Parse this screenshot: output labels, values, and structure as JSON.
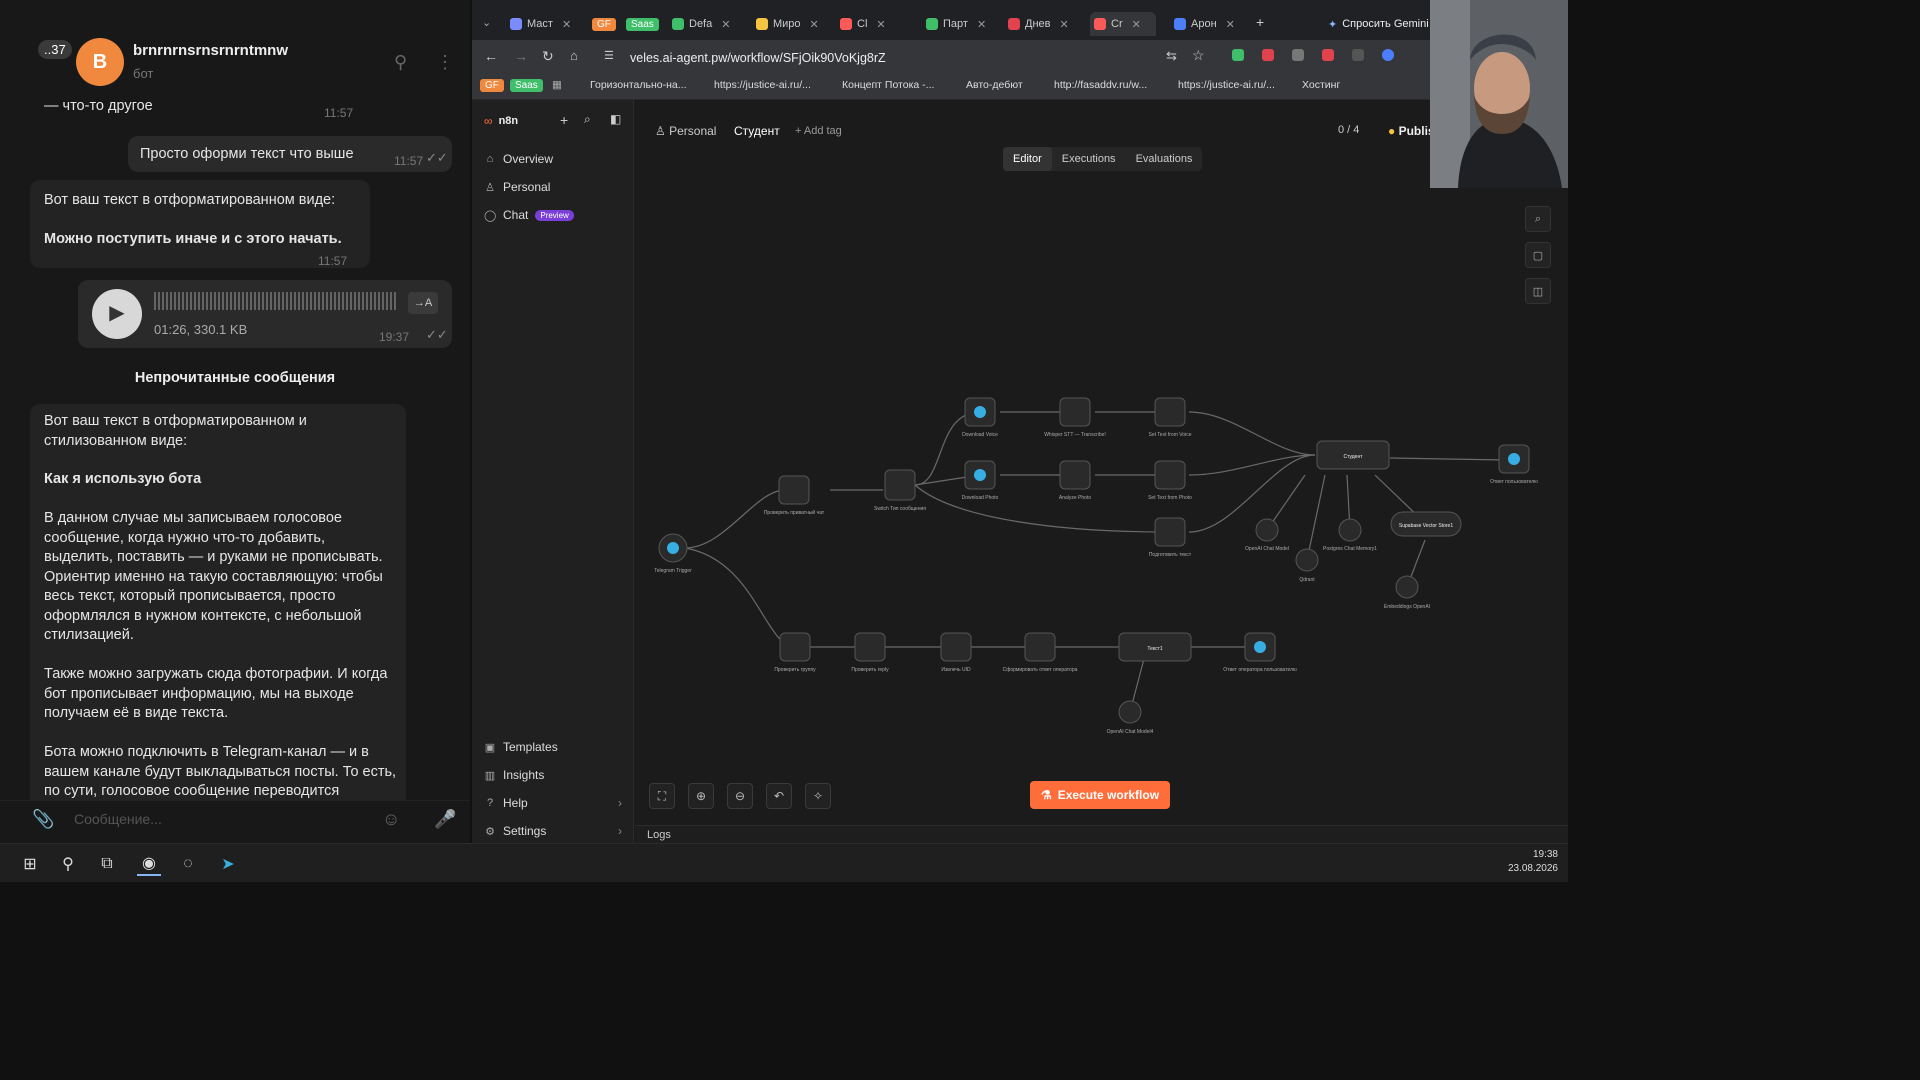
{
  "telegram": {
    "unread_badge": "..37",
    "avatar_letter": "B",
    "chat_name": "brnrnrnsrnsrnrntmnw",
    "chat_status": "бот",
    "messages": [
      {
        "text": "— что-то другое",
        "time": "11:57"
      },
      {
        "text": "Просто оформи текст что выше",
        "time": "11:57",
        "outgoing": true
      },
      {
        "line1": "Вот ваш текст в отформатированном виде:",
        "line2": "Можно поступить иначе и с этого начать.",
        "time": "11:57"
      }
    ],
    "voice": {
      "duration_size": "01:26, 330.1 KB",
      "time": "19:37",
      "transcribe_label": "→A"
    },
    "unread_divider": "Непрочитанные сообщения",
    "long_message": {
      "intro": "Вот ваш текст в отформатированном и стилизованном виде:",
      "heading": "Как я использую бота",
      "p1": "В данном случае мы записываем голосовое сообщение, когда нужно что-то добавить, выделить, поставить — и руками не прописывать. Ориентир именно на такую составляющую: чтобы весь текст, который прописывается, просто оформлялся в нужном контексте, с небольшой стилизацией.",
      "p2": "Также можно загружать сюда фотографии. И когда бот прописывает информацию, мы на выходе получаем её в виде текста.",
      "p3": "Бота можно подключить в Telegram-канал — и в вашем канале будут выкладываться посты. То есть, по сути, голосовое сообщение переводится"
    },
    "input_placeholder": "Сообщение..."
  },
  "browser": {
    "tabs": [
      {
        "label": "Маст",
        "color": "#7a8cff"
      },
      {
        "label": "GF",
        "color": "#f0883e"
      },
      {
        "label": "Saas",
        "color": "#3fbf6a"
      },
      {
        "label": "Defa",
        "color": "#3fbf6a"
      },
      {
        "label": "Миро",
        "color": "#f5c542"
      },
      {
        "label": "Cl",
        "color": "#ff5a5a"
      },
      {
        "label": "Парт",
        "color": "#3fbf6a"
      },
      {
        "label": "Днев",
        "color": "#e0434e"
      },
      {
        "label": "Cr",
        "color": "#ff5a5a"
      },
      {
        "label": "Арон",
        "color": "#4c7fff"
      }
    ],
    "gemini": "Спросить Gemini",
    "url": "veles.ai-agent.pw/workflow/SFjOik90VoKjg8rZ",
    "bookmarks": [
      {
        "label": "GF"
      },
      {
        "label": "Saas"
      },
      {
        "label": "Горизонтально-на..."
      },
      {
        "label": "https://justice-ai.ru/..."
      },
      {
        "label": "Концепт Потока -..."
      },
      {
        "label": "Авто-дебют"
      },
      {
        "label": "http://fasaddv.ru/w..."
      },
      {
        "label": "https://justice-ai.ru/..."
      },
      {
        "label": "Хостинг"
      }
    ]
  },
  "n8n": {
    "brand": "n8n",
    "nav": {
      "overview": "Overview",
      "personal": "Personal",
      "chat": "Chat",
      "chat_badge": "Preview"
    },
    "bottom_nav": {
      "templates": "Templates",
      "insights": "Insights",
      "help": "Help",
      "settings": "Settings"
    },
    "breadcrumb": {
      "project": "Personal",
      "workflow": "Студент",
      "add_tag": "+ Add tag"
    },
    "counter": "0 / 4",
    "publish": "Publis",
    "modes": [
      "Editor",
      "Executions",
      "Evaluations"
    ],
    "execute": "Execute workflow",
    "logs": "Logs",
    "nodes": {
      "telegram_trigger": "Telegram Trigger",
      "check_private": "Проверить приватный чат",
      "switch": "Switch Тип сообщения",
      "download_voice": "Download Voice",
      "whisper": "Whisper STT — Transcribe!",
      "set_text_voice": "Set Text from Voice",
      "download_photo": "Download Photo",
      "analyze_photo": "Analyze Photo",
      "set_text_photo": "Set Text from Photo",
      "prepare_text": "Подготовить текст",
      "agent": "Студент",
      "reply": "Ответ пользователю",
      "openai_model": "OpenAI Chat Model",
      "postgres": "Postgres Chat Memory1",
      "qdrant": "Qdrant",
      "supabase": "Supabase Vector Store1",
      "embeddings": "Embeddings OpenAI",
      "check_group": "Проверить группу",
      "check_reply": "Проверить reply",
      "extract_uid": "Извлечь UID",
      "form_reply": "Сформировать ответ оператора",
      "agent2": "Текст1",
      "reply_op": "Ответ оператора пользователю",
      "openai_model2": "OpenAI Chat Model4"
    }
  },
  "taskbar": {
    "time": "19:38",
    "date": "23.08.2026"
  }
}
